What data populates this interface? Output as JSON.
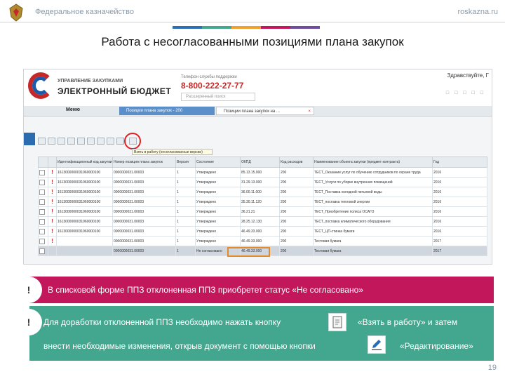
{
  "header": {
    "org_name": "Федеральное казначейство",
    "site": "roskazna.ru",
    "stripe_colors": [
      "#2e6fb3",
      "#43a78f",
      "#f0a030",
      "#c2185b",
      "#6f4ca0"
    ]
  },
  "page_title": "Работа с несогласованными позициями плана закупок",
  "screenshot": {
    "logo_sub": "УПРАВЛЕНИЕ ЗАКУПКАМИ",
    "logo_main": "ЭЛЕКТРОННЫЙ БЮДЖЕТ",
    "support_label": "Телефон службы поддержки",
    "support_phone": "8-800-222-27-77",
    "search_placeholder": "Расширенный поиск",
    "greeting": "Здравствуйте, Г",
    "menu_label": "Меню",
    "tabs": [
      {
        "label": "Позиции плана закупок - 200"
      },
      {
        "label": "Позиции плана закупок на ..."
      }
    ],
    "tooltip": "Взять в работу (несогласованные версии)",
    "table": {
      "headers": [
        "",
        "",
        "Идентификационный код закупки",
        "Номер позиции плана закупок",
        "Версия",
        "Состояние",
        "ОКПД",
        "Код расходов",
        "Наименование объекта закупки (предмет контракта)",
        "Год"
      ],
      "rows": [
        {
          "flag": "!",
          "ikz": "1613000000031960000100",
          "num": "0000000031.00003",
          "ver": "1",
          "state": "Утверждено",
          "okpd": "85.13.15.000",
          "kbk": "200",
          "name": "ТЕСТ_Оказание услуг по обучению сотрудников по охране труда",
          "year": "2016",
          "selected": false
        },
        {
          "flag": "!",
          "ikz": "1613000000031960000100",
          "num": "0000000031.00003",
          "ver": "1",
          "state": "Утверждено",
          "okpd": "31.29.13.000",
          "kbk": "200",
          "name": "ТЕСТ_Услуги по уборке внутренних помещений",
          "year": "2016",
          "selected": false
        },
        {
          "flag": "!",
          "ikz": "1613000000031960000100",
          "num": "0000000031.00003",
          "ver": "1",
          "state": "Утверждено",
          "okpd": "36.00.11.000",
          "kbk": "200",
          "name": "ТЕСТ_Поставка холодной питьевой воды",
          "year": "2016",
          "selected": false
        },
        {
          "flag": "!",
          "ikz": "1613000000031960000100",
          "num": "0000000031.00003",
          "ver": "1",
          "state": "Утверждено",
          "okpd": "35.30.11.120",
          "kbk": "200",
          "name": "ТЕСТ_поставка тепловой энергии",
          "year": "2016",
          "selected": false
        },
        {
          "flag": "!",
          "ikz": "1613000000031960000100",
          "num": "0000000031.00003",
          "ver": "1",
          "state": "Утверждено",
          "okpd": "36.21.21",
          "kbk": "200",
          "name": "ТЕСТ_Приобретение полиса ОСАГО",
          "year": "2016",
          "selected": false
        },
        {
          "flag": "!",
          "ikz": "1613000000031960000100",
          "num": "0000000031.00003",
          "ver": "1",
          "state": "Утверждено",
          "okpd": "28.25.12.130",
          "kbk": "200",
          "name": "ТЕСТ_поставка климатического оборудования",
          "year": "2016",
          "selected": false
        },
        {
          "flag": "!",
          "ikz": "1613000000031960000100",
          "num": "0000000031.00003",
          "ver": "1",
          "state": "Утверждено",
          "okpd": "46.49.33.000",
          "kbk": "200",
          "name": "ТЕСТ_ЦП-стинка бумаги",
          "year": "2016",
          "selected": false
        },
        {
          "flag": "!",
          "ikz": "",
          "num": "0000000031.00003",
          "ver": "1",
          "state": "Утверждено",
          "okpd": "46.49.33.000",
          "kbk": "200",
          "name": "Тестовая бумага",
          "year": "2017",
          "selected": false
        },
        {
          "flag": "",
          "ikz": "",
          "num": "0000000031.00003",
          "ver": "1",
          "state": "Не согласовано",
          "okpd": "46.49.33.000",
          "kbk": "200",
          "name": "Тестовая бумага",
          "year": "2017",
          "selected": true
        }
      ]
    }
  },
  "notes": [
    {
      "mark": "!",
      "text": "В списковой форме ППЗ отклоненная ППЗ приобретет статус «Не согласовано»"
    },
    {
      "mark": "!",
      "text_a": "Для доработки отклоненной ППЗ необходимо нажать кнопку",
      "text_b": "«Взять в работу» и затем",
      "text_c": "внести необходимые изменения, открыв документ с помощью кнопки",
      "text_d": "«Редактирование»"
    }
  ],
  "page_number": "19",
  "colors": {
    "note_red": "#c2185b",
    "note_green": "#43a78f",
    "highlight_red": "#e02020",
    "highlight_orange": "#e58a2b"
  }
}
